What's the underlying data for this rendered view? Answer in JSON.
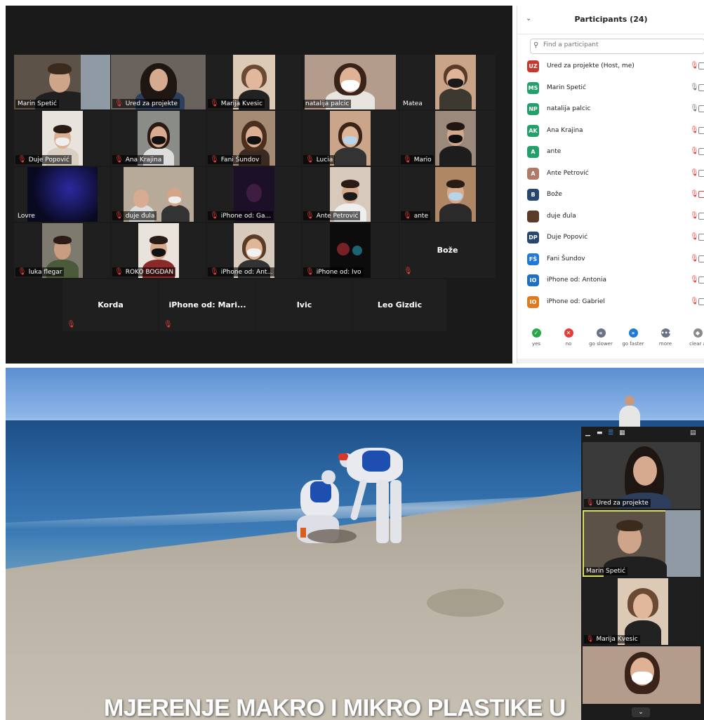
{
  "gallery": {
    "tiles": [
      "Marin Spetić",
      "Ured za projekte",
      "Marija Kvesic",
      "natalija palcic",
      "Matea",
      "Duje Popović",
      "Ana Krajina",
      "Fani Šundov",
      "Lucia",
      "Mario",
      "Lovre",
      "duje đula",
      "iPhone od: Ga...",
      "Ante Petrović",
      "ante",
      "luka flegar",
      "ROKO BOGDAN",
      "iPhone od: Ant...",
      "iPhone od: Ivo",
      "Bože",
      "Korda",
      "iPhone od: Mari...",
      "Ivic",
      "Leo Gizdic"
    ]
  },
  "participants": {
    "title": "Participants (24)",
    "search_placeholder": "Find a participant",
    "items": [
      {
        "initials": "UZ",
        "name": "Ured za projekte (Host, me)",
        "color": "#c8372d"
      },
      {
        "initials": "MS",
        "name": "Marin Spetić",
        "color": "#22a06b"
      },
      {
        "initials": "NP",
        "name": "natalija palcic",
        "color": "#22a06b"
      },
      {
        "initials": "AK",
        "name": "Ana Krajina",
        "color": "#22a06b"
      },
      {
        "initials": "A",
        "name": "ante",
        "color": "#22a06b"
      },
      {
        "initials": "A",
        "name": "Ante Petrović",
        "color": "#b07a68"
      },
      {
        "initials": "B",
        "name": "Bože",
        "color": "#27466e"
      },
      {
        "initials": "",
        "name": "duje đula",
        "color": "#5a3b2a"
      },
      {
        "initials": "DP",
        "name": "Duje Popović",
        "color": "#27466e"
      },
      {
        "initials": "FŠ",
        "name": "Fani Šundov",
        "color": "#1f7ad6"
      },
      {
        "initials": "IO",
        "name": "iPhone od: Antonia",
        "color": "#1f6fc4"
      },
      {
        "initials": "IO",
        "name": "iPhone od: Gabriel",
        "color": "#e07a1f"
      }
    ],
    "reactions": [
      {
        "label": "yes",
        "color": "#2aa847",
        "glyph": "✓"
      },
      {
        "label": "no",
        "color": "#e0403a",
        "glyph": "✕"
      },
      {
        "label": "go slower",
        "color": "#6b7485",
        "glyph": "«"
      },
      {
        "label": "go faster",
        "color": "#1f7ad6",
        "glyph": "»"
      },
      {
        "label": "more",
        "color": "#6b7485",
        "glyph": "•••"
      },
      {
        "label": "clear a",
        "color": "#8a8a8a",
        "glyph": "◆"
      }
    ]
  },
  "video": {
    "caption": "MJERENJE MAKRO I MIKRO PLASTIKE U",
    "thumbnails": [
      "Ured za projekte",
      "Marin Spetić",
      "Marija Kvesic"
    ]
  }
}
